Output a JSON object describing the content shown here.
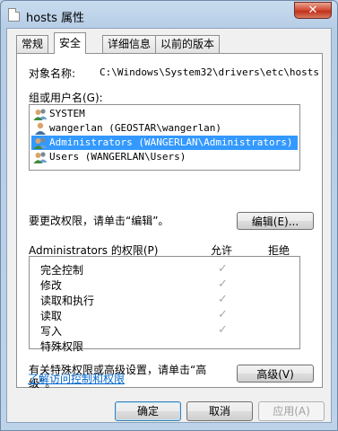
{
  "window": {
    "title": "hosts 属性",
    "close_glyph": "✕"
  },
  "tabs": [
    {
      "label": "常规",
      "active": false
    },
    {
      "label": "安全",
      "active": true
    },
    {
      "label": "详细信息",
      "active": false
    },
    {
      "label": "以前的版本",
      "active": false
    }
  ],
  "security": {
    "object_name_label": "对象名称:",
    "object_name_value": "C:\\Windows\\System32\\drivers\\etc\\hosts",
    "group_label": "组或用户名(G):",
    "users": [
      {
        "label": "SYSTEM",
        "selected": false
      },
      {
        "label": "wangerlan (GEOSTAR\\wangerlan)",
        "selected": false
      },
      {
        "label": "Administrators (WANGERLAN\\Administrators)",
        "selected": true
      },
      {
        "label": "Users (WANGERLAN\\Users)",
        "selected": false
      }
    ],
    "change_hint": "要更改权限，请单击“编辑”。",
    "edit_button": "编辑(E)...",
    "permissions_for": "Administrators 的权限(P)",
    "allow_header": "允许",
    "deny_header": "拒绝",
    "permissions": [
      {
        "label": "完全控制",
        "allow": "✓"
      },
      {
        "label": "修改",
        "allow": "✓"
      },
      {
        "label": "读取和执行",
        "allow": "✓"
      },
      {
        "label": "读取",
        "allow": "✓"
      },
      {
        "label": "写入",
        "allow": "✓"
      },
      {
        "label": "特殊权限",
        "allow": ""
      }
    ],
    "advanced_hint_line1": "有关特殊权限或高级设置，请单击“高",
    "advanced_hint_line2": "级”。",
    "advanced_button": "高级(V)",
    "learn_link": "了解访问控制和权限"
  },
  "footer": {
    "ok": "确定",
    "cancel": "取消",
    "apply": "应用(A)"
  },
  "colors": {
    "selection": "#3399ff",
    "link": "#0066cc",
    "close_button": "#c1301a"
  }
}
